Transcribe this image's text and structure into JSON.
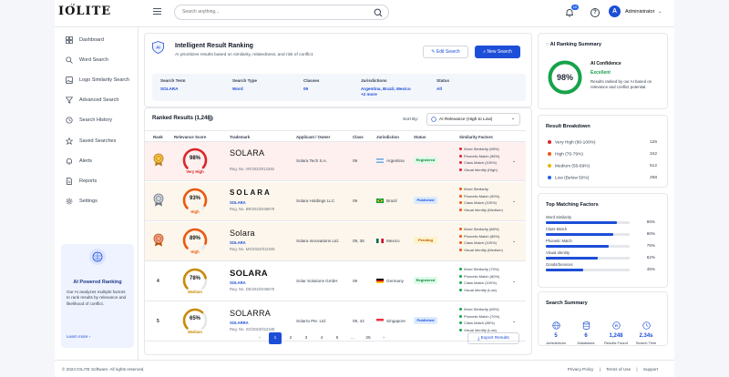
{
  "app": {
    "logo": "IOLITE",
    "logo_sub": "ip",
    "user": "Administrator",
    "avatar_initial": "A",
    "notifications": "10"
  },
  "search": {
    "placeholder": "Search anything..."
  },
  "sidebar": {
    "items": [
      {
        "label": "Dashboard",
        "icon": "grid-icon"
      },
      {
        "label": "Word Search",
        "icon": "search-icon"
      },
      {
        "label": "Logo Similarity Search",
        "icon": "image-icon"
      },
      {
        "label": "Advanced Search",
        "icon": "filter-icon"
      },
      {
        "label": "Search History",
        "icon": "history-icon"
      },
      {
        "label": "Saved Searches",
        "icon": "star-icon"
      },
      {
        "label": "Alerts",
        "icon": "bell-icon"
      },
      {
        "label": "Reports",
        "icon": "document-icon"
      },
      {
        "label": "Settings",
        "icon": "gear-icon"
      }
    ],
    "ai_card": {
      "title": "AI Powered Ranking",
      "desc": "Our AI analyzes multiple factors to rank results by relevance and likelihood of conflict.",
      "link": "Learn more"
    }
  },
  "header": {
    "title": "Intelligent Result Ranking",
    "subtitle": "AI prioritizes results based on similarity, relatedness, and risk of conflict.",
    "edit_btn": "Edit Search",
    "new_btn": "New Search",
    "summary": [
      {
        "key": "Search Term",
        "value": "SOLARA",
        "value2": ""
      },
      {
        "key": "Search Type",
        "value": "Word",
        "value2": ""
      },
      {
        "key": "Classes",
        "value": "09",
        "value2": ""
      },
      {
        "key": "Jurisdictions",
        "value": "Argentina, Brazil, Mexico",
        "value2": "+2 more"
      },
      {
        "key": "Status",
        "value": "All",
        "value2": ""
      }
    ]
  },
  "results": {
    "title": "Ranked Results (1,248)",
    "sort_label": "Sort By:",
    "sort_value": "AI Relevance (High to Low)",
    "columns": [
      "Rank",
      "Relevance Score",
      "Trademark",
      "Applicant / Owner",
      "Class",
      "Jurisdiction",
      "Status",
      "Similarity Factors"
    ],
    "rows": [
      {
        "rank": "",
        "medal": "gold",
        "score": "98%",
        "score_num": 98,
        "level": "Very High",
        "level_color": "#dc2626",
        "tm": "SOLARA",
        "tm_style": "plain",
        "tm_sub": "",
        "reg": "Reg. No. AR/2023/012345",
        "owner": "Solara Tech S.A.",
        "class": "09",
        "country": "Argentina",
        "flag": "ar",
        "status": "Registered",
        "status_type": "registered",
        "bg": "#fdf0ef",
        "factors": [
          {
            "t": "Word Similarity (98%)",
            "c": "#dc2626"
          },
          {
            "t": "Phonetic Match (96%)",
            "c": "#dc2626"
          },
          {
            "t": "Class Match (100%)",
            "c": "#dc2626"
          },
          {
            "t": "Visual Identity (High)",
            "c": "#dc2626"
          }
        ]
      },
      {
        "rank": "",
        "medal": "silver",
        "score": "93%",
        "score_num": 93,
        "level": "High",
        "level_color": "#ea580c",
        "tm": "SOLARA",
        "tm_style": "wide",
        "tm_sub": "SOLARA",
        "reg": "Reg. No. BR/2023/045678",
        "owner": "Solara Holdings LLC",
        "class": "09",
        "country": "Brazil",
        "flag": "br",
        "status": "Published",
        "status_type": "published",
        "bg": "#fdf6ec",
        "factors": [
          {
            "t": "Word Similarity",
            "c": "#ea580c"
          },
          {
            "t": "Phonetic Match (90%)",
            "c": "#ea580c"
          },
          {
            "t": "Class Match (100%)",
            "c": "#ea580c"
          },
          {
            "t": "Visual Identity (Medium)",
            "c": "#ea580c"
          }
        ]
      },
      {
        "rank": "",
        "medal": "bronze",
        "score": "89%",
        "score_num": 89,
        "level": "High",
        "level_color": "#ea580c",
        "tm": "Solara",
        "tm_style": "script",
        "tm_sub": "SOLARA",
        "reg": "Reg. No. MX/2024/012345",
        "owner": "Solara Innovations Ltd.",
        "class": "09, 35",
        "country": "Mexico",
        "flag": "mx",
        "status": "Pending",
        "status_type": "pending",
        "bg": "#fdf6ec",
        "factors": [
          {
            "t": "Word Similarity (88%)",
            "c": "#ea580c"
          },
          {
            "t": "Phonetic Match (85%)",
            "c": "#ea580c"
          },
          {
            "t": "Class Match (100%)",
            "c": "#ea580c"
          },
          {
            "t": "Visual Identity (Medium)",
            "c": "#ea580c"
          }
        ]
      },
      {
        "rank": "4",
        "medal": "",
        "score": "78%",
        "score_num": 78,
        "level": "Medium",
        "level_color": "#ca8a04",
        "tm": "SOLARA",
        "tm_style": "bold",
        "tm_sub": "SOLARA",
        "reg": "Reg. No. DE/2022/045678",
        "owner": "Solar Solutions GmbH",
        "class": "09",
        "country": "Germany",
        "flag": "de",
        "status": "Registered",
        "status_type": "registered",
        "bg": "#ffffff",
        "factors": [
          {
            "t": "Word Similarity (75%)",
            "c": "#16a34a"
          },
          {
            "t": "Phonetic Match (80%)",
            "c": "#16a34a"
          },
          {
            "t": "Class Match (100%)",
            "c": "#16a34a"
          },
          {
            "t": "Visual Identity (Low)",
            "c": "#16a34a"
          }
        ]
      },
      {
        "rank": "5",
        "medal": "",
        "score": "65%",
        "score_num": 65,
        "level": "Medium",
        "level_color": "#ca8a04",
        "tm": "SOLARRA",
        "tm_style": "plain",
        "tm_sub": "SOLARRA",
        "reg": "Reg. No. SG/2023/012345",
        "owner": "Solarra Pte. Ltd.",
        "class": "09, 42",
        "country": "Singapore",
        "flag": "sg",
        "status": "Published",
        "status_type": "published",
        "bg": "#ffffff",
        "factors": [
          {
            "t": "Word Similarity (65%)",
            "c": "#16a34a"
          },
          {
            "t": "Phonetic Match (70%)",
            "c": "#16a34a"
          },
          {
            "t": "Class Match (85%)",
            "c": "#16a34a"
          },
          {
            "t": "Visual Identity (Low)",
            "c": "#16a34a"
          }
        ]
      }
    ],
    "pages": [
      "1",
      "2",
      "3",
      "4",
      "5",
      "...",
      "25"
    ],
    "export": "Export Results"
  },
  "ai_summary": {
    "title": "AI Ranking Summary",
    "value": "98%",
    "value_num": 98,
    "conf_label": "AI Confidence",
    "conf_value": "Excellent",
    "desc": "Results ranked by our AI based on relevance and conflict potential."
  },
  "breakdown": {
    "title": "Result Breakdown",
    "items": [
      {
        "label": "Very High (80-100%)",
        "count": "126",
        "color": "#dc2626"
      },
      {
        "label": "High (70-79%)",
        "count": "342",
        "color": "#ea580c"
      },
      {
        "label": "Medium (50-69%)",
        "count": "512",
        "color": "#eab308"
      },
      {
        "label": "Low (Below 50%)",
        "count": "268",
        "color": "#2563eb"
      }
    ]
  },
  "factors": {
    "title": "Top Matching Factors",
    "items": [
      {
        "label": "Word Similarity",
        "pct": "85%",
        "value": 85
      },
      {
        "label": "Class Match",
        "pct": "80%",
        "value": 80
      },
      {
        "label": "Phonetic Match",
        "pct": "75%",
        "value": 75
      },
      {
        "label": "Visual Identity",
        "pct": "62%",
        "value": 62
      },
      {
        "label": "Goods/Services",
        "pct": "45%",
        "value": 45
      }
    ]
  },
  "search_summary": {
    "title": "Search Summary",
    "items": [
      {
        "value": "5",
        "label": "Jurisdictions",
        "icon": "globe-icon"
      },
      {
        "value": "6",
        "label": "Databases",
        "icon": "database-icon"
      },
      {
        "value": "1,248",
        "label": "Results Found",
        "icon": "trademark-icon"
      },
      {
        "value": "2.34s",
        "label": "Search Time",
        "icon": "clock-icon"
      }
    ]
  },
  "footer": {
    "copy": "© 2024 IOLITE Software. All rights reserved.",
    "links": [
      "Privacy Policy",
      "|",
      "Terms of Use",
      "|",
      "Support"
    ]
  }
}
